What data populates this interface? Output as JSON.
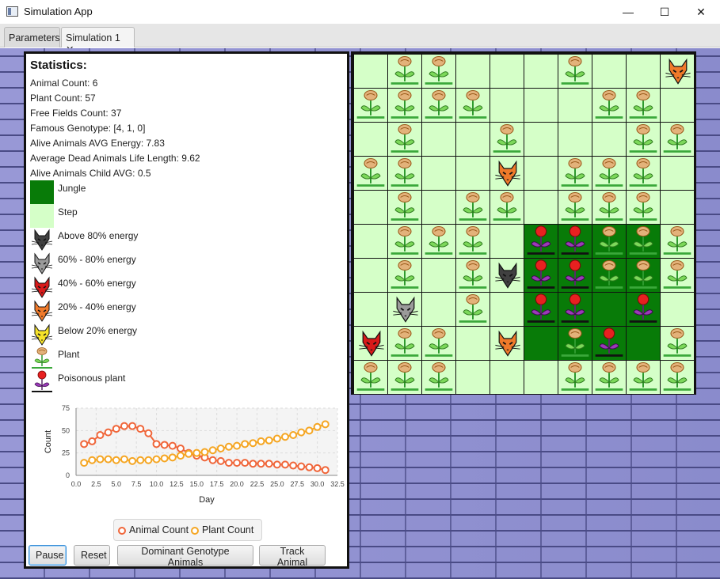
{
  "window": {
    "title": "Simulation App",
    "minimize": "—",
    "maximize": "☐",
    "close": "✕"
  },
  "tabs": [
    {
      "label": "Parameters",
      "active": false
    },
    {
      "label": "Simulation 1",
      "active": true,
      "close": "✕"
    }
  ],
  "stats": {
    "heading": "Statistics:",
    "lines": [
      "Animal Count: 6",
      "Plant Count: 57",
      "Free Fields Count: 37",
      "Famous Genotype: [4, 1, 0]",
      "Alive Animals AVG Energy: 7.83",
      "Average Dead Animals Life Length: 9.62",
      "Alive Animals Child AVG: 0.5"
    ]
  },
  "legend": [
    {
      "label": "Jungle",
      "icon": "jungle-swatch",
      "color": "#087b08"
    },
    {
      "label": "Step",
      "icon": "step-swatch",
      "color": "#d5ffc8"
    },
    {
      "label": "Above 80% energy",
      "icon": "animal-icon",
      "color": "#404040"
    },
    {
      "label": "60% - 80% energy",
      "icon": "animal-icon",
      "color": "#9a9a9a"
    },
    {
      "label": "40% - 60% energy",
      "icon": "animal-icon",
      "color": "#d81a1a"
    },
    {
      "label": "20% - 40% energy",
      "icon": "animal-icon",
      "color": "#f07a2a"
    },
    {
      "label": "Below 20% energy",
      "icon": "animal-icon",
      "color": "#f5e22a"
    },
    {
      "label": "Plant",
      "icon": "plant-icon",
      "color": "#d99a55"
    },
    {
      "label": "Poisonous plant",
      "icon": "poison-plant-icon",
      "color": "#e01a1a"
    }
  ],
  "chart_data": {
    "type": "line",
    "xlabel": "Day",
    "ylabel": "Count",
    "xlim": [
      0,
      32.5
    ],
    "ylim": [
      0,
      75
    ],
    "xticks": [
      "0.0",
      "2.5",
      "5.0",
      "7.5",
      "10.0",
      "12.5",
      "15.0",
      "17.5",
      "20.0",
      "22.5",
      "25.0",
      "27.5",
      "30.0",
      "32.5"
    ],
    "yticks": [
      "0",
      "25",
      "50",
      "75"
    ],
    "x": [
      1,
      2,
      3,
      4,
      5,
      6,
      7,
      8,
      9,
      10,
      11,
      12,
      13,
      14,
      15,
      16,
      17,
      18,
      19,
      20,
      21,
      22,
      23,
      24,
      25,
      26,
      27,
      28,
      29,
      30,
      31
    ],
    "series": [
      {
        "name": "Animal Count",
        "color": "#f0663a",
        "values": [
          35,
          38,
          45,
          48,
          52,
          55,
          55,
          52,
          47,
          35,
          34,
          33,
          30,
          25,
          22,
          20,
          17,
          16,
          14,
          14,
          14,
          13,
          13,
          13,
          12,
          12,
          11,
          10,
          9,
          8,
          6
        ]
      },
      {
        "name": "Plant Count",
        "color": "#f5a623",
        "values": [
          14,
          17,
          18,
          18,
          17,
          18,
          16,
          17,
          17,
          18,
          19,
          20,
          22,
          24,
          25,
          26,
          28,
          30,
          32,
          33,
          35,
          36,
          38,
          39,
          41,
          43,
          45,
          48,
          50,
          54,
          57
        ]
      }
    ],
    "legend_position": "bottom",
    "grid": true
  },
  "buttons": {
    "pause": "Pause",
    "reset": "Reset",
    "dominant": "Dominant Genotype Animals",
    "track": "Track Animal"
  },
  "map": {
    "cols": 10,
    "rows": 10,
    "jungle": [
      [
        5,
        5
      ],
      [
        6,
        5
      ],
      [
        7,
        5
      ],
      [
        8,
        5
      ],
      [
        5,
        6
      ],
      [
        6,
        6
      ],
      [
        7,
        6
      ],
      [
        8,
        6
      ],
      [
        5,
        7
      ],
      [
        6,
        7
      ],
      [
        7,
        7
      ],
      [
        8,
        7
      ],
      [
        5,
        8
      ],
      [
        6,
        8
      ],
      [
        7,
        8
      ],
      [
        8,
        8
      ]
    ],
    "plants": [
      [
        1,
        0
      ],
      [
        2,
        0
      ],
      [
        6,
        0
      ],
      [
        0,
        1
      ],
      [
        1,
        1
      ],
      [
        2,
        1
      ],
      [
        3,
        1
      ],
      [
        7,
        1
      ],
      [
        8,
        1
      ],
      [
        1,
        2
      ],
      [
        4,
        2
      ],
      [
        8,
        2
      ],
      [
        9,
        2
      ],
      [
        0,
        3
      ],
      [
        1,
        3
      ],
      [
        6,
        3
      ],
      [
        7,
        3
      ],
      [
        8,
        3
      ],
      [
        1,
        4
      ],
      [
        3,
        4
      ],
      [
        4,
        4
      ],
      [
        6,
        4
      ],
      [
        7,
        4
      ],
      [
        8,
        4
      ],
      [
        1,
        5
      ],
      [
        2,
        5
      ],
      [
        3,
        5
      ],
      [
        7,
        5
      ],
      [
        8,
        5
      ],
      [
        9,
        5
      ],
      [
        1,
        6
      ],
      [
        3,
        6
      ],
      [
        7,
        6
      ],
      [
        8,
        6
      ],
      [
        9,
        6
      ],
      [
        3,
        7
      ],
      [
        6,
        7
      ],
      [
        1,
        8
      ],
      [
        2,
        8
      ],
      [
        6,
        8
      ],
      [
        7,
        8
      ],
      [
        9,
        8
      ],
      [
        0,
        9
      ],
      [
        1,
        9
      ],
      [
        2,
        9
      ],
      [
        6,
        9
      ],
      [
        7,
        9
      ],
      [
        8,
        9
      ],
      [
        9,
        9
      ]
    ],
    "poison": [
      [
        5,
        5
      ],
      [
        6,
        5
      ],
      [
        5,
        6
      ],
      [
        6,
        6
      ],
      [
        5,
        7
      ],
      [
        6,
        7
      ],
      [
        8,
        7
      ],
      [
        7,
        8
      ]
    ],
    "animals": [
      {
        "x": 9,
        "y": 0,
        "color": "#f07a2a"
      },
      {
        "x": 4,
        "y": 3,
        "color": "#f07a2a"
      },
      {
        "x": 4,
        "y": 6,
        "color": "#404040"
      },
      {
        "x": 1,
        "y": 7,
        "color": "#9a9a9a"
      },
      {
        "x": 0,
        "y": 8,
        "color": "#d81a1a"
      },
      {
        "x": 4,
        "y": 8,
        "color": "#f07a2a"
      }
    ]
  }
}
